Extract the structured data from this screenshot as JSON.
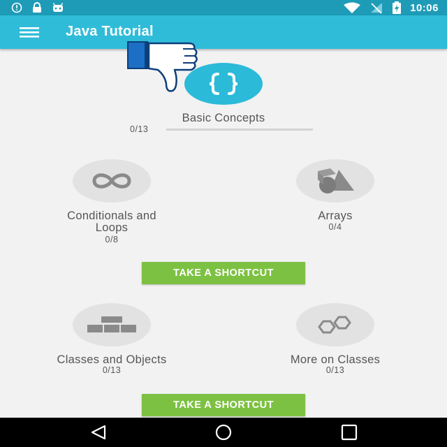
{
  "status_bar": {
    "time": "10:06",
    "icons": [
      "info-icon",
      "lock-icon",
      "android-icon",
      "wifi-icon",
      "no-signal-icon",
      "battery-charging-icon"
    ]
  },
  "app_bar": {
    "title": "Java Tutorial",
    "menu_icon": "hamburger-menu-icon"
  },
  "colors": {
    "app_bar": "#2fbcd9",
    "status_bar": "#1e9bb7",
    "accent": "#2bbad8",
    "shortcut_button": "#7dc142",
    "locked_circle": "#e2e2e2"
  },
  "overlay": {
    "icon": "thumbs-down-icon"
  },
  "lessons": {
    "basic": {
      "title": "Basic Concepts",
      "count": "0/13",
      "progress": 0,
      "icon": "curly-braces-icon"
    },
    "conditionals": {
      "title_line1": "Conditionals and",
      "title_line2": "Loops",
      "count": "0/8",
      "icon": "infinity-icon"
    },
    "arrays": {
      "title": "Arrays",
      "count": "0/4",
      "icon": "shapes-icon"
    },
    "classes": {
      "title": "Classes and Objects",
      "count": "0/13",
      "icon": "hierarchy-icon"
    },
    "more_classes": {
      "title": "More on Classes",
      "count": "0/13",
      "icon": "hexagons-icon"
    }
  },
  "shortcut_buttons": [
    "TAKE A SHORTCUT",
    "TAKE A SHORTCUT"
  ],
  "nav_bar": {
    "back_icon": "back-triangle-icon",
    "home_icon": "home-circle-icon",
    "recents_icon": "recents-square-icon"
  }
}
